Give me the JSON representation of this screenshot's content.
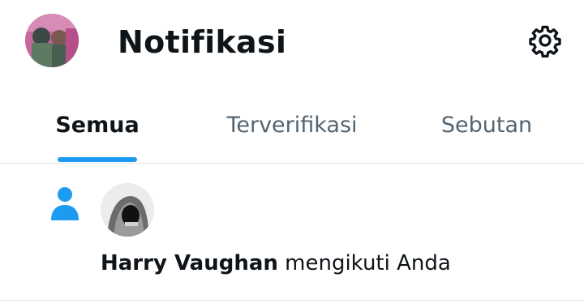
{
  "header": {
    "title": "Notifikasi",
    "avatar_icon": "profile-avatar",
    "settings_icon": "gear-icon"
  },
  "tabs": [
    {
      "label": "Semua",
      "active": true
    },
    {
      "label": "Terverifikasi",
      "active": false
    },
    {
      "label": "Sebutan",
      "active": false
    }
  ],
  "notification": {
    "type_icon": "person-icon",
    "user_name": "Harry Vaughan",
    "action_text": " mengikuti Anda"
  },
  "colors": {
    "accent": "#1d9bf0",
    "text_primary": "#0f1419",
    "text_secondary": "#536471",
    "divider": "#dfe3e6"
  }
}
